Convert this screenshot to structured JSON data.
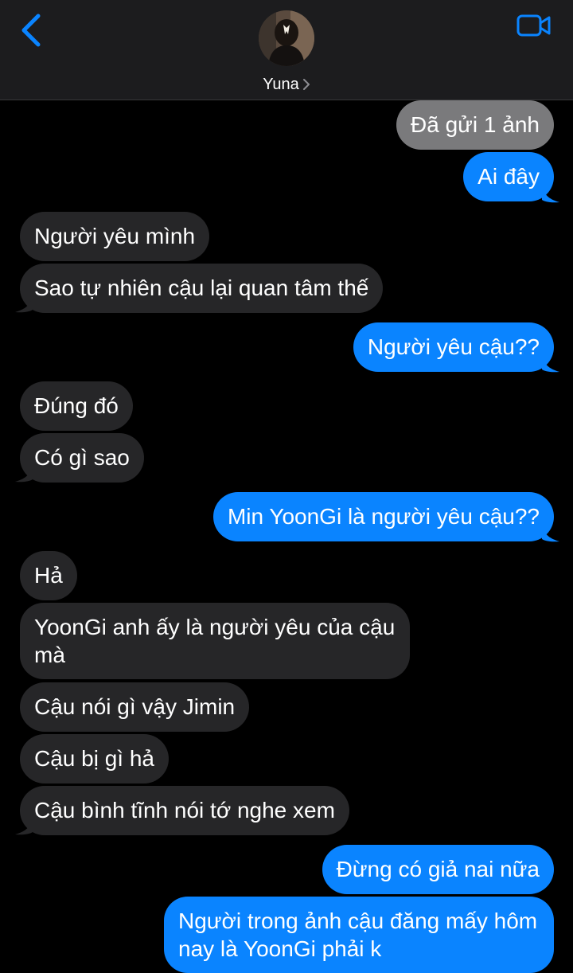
{
  "header": {
    "contact_name": "Yuna",
    "accent": "#0a84ff",
    "back_icon": "chevron-left-icon",
    "video_icon": "video-camera-icon"
  },
  "messages": [
    {
      "from": "me",
      "text": "Đã gửi 1 ảnh",
      "kind": "media-notice"
    },
    {
      "from": "me",
      "text": "Ai đây"
    },
    {
      "from": "them",
      "text": "Người yêu mình"
    },
    {
      "from": "them",
      "text": "Sao tự nhiên cậu lại quan tâm thế"
    },
    {
      "from": "me",
      "text": "Người yêu cậu??"
    },
    {
      "from": "them",
      "text": "Đúng đó"
    },
    {
      "from": "them",
      "text": "Có gì sao"
    },
    {
      "from": "me",
      "text": "Min YoonGi là người yêu cậu??"
    },
    {
      "from": "them",
      "text": "Hả"
    },
    {
      "from": "them",
      "text": "YoonGi anh ấy là người yêu của cậu mà"
    },
    {
      "from": "them",
      "text": "Cậu nói gì vậy Jimin"
    },
    {
      "from": "them",
      "text": "Cậu bị gì hả"
    },
    {
      "from": "them",
      "text": "Cậu bình tĩnh nói tớ nghe xem"
    },
    {
      "from": "me",
      "text": "Đừng có giả nai nữa"
    },
    {
      "from": "me",
      "text": "Người trong ảnh cậu đăng mấy hôm nay là YoonGi phải k"
    }
  ]
}
